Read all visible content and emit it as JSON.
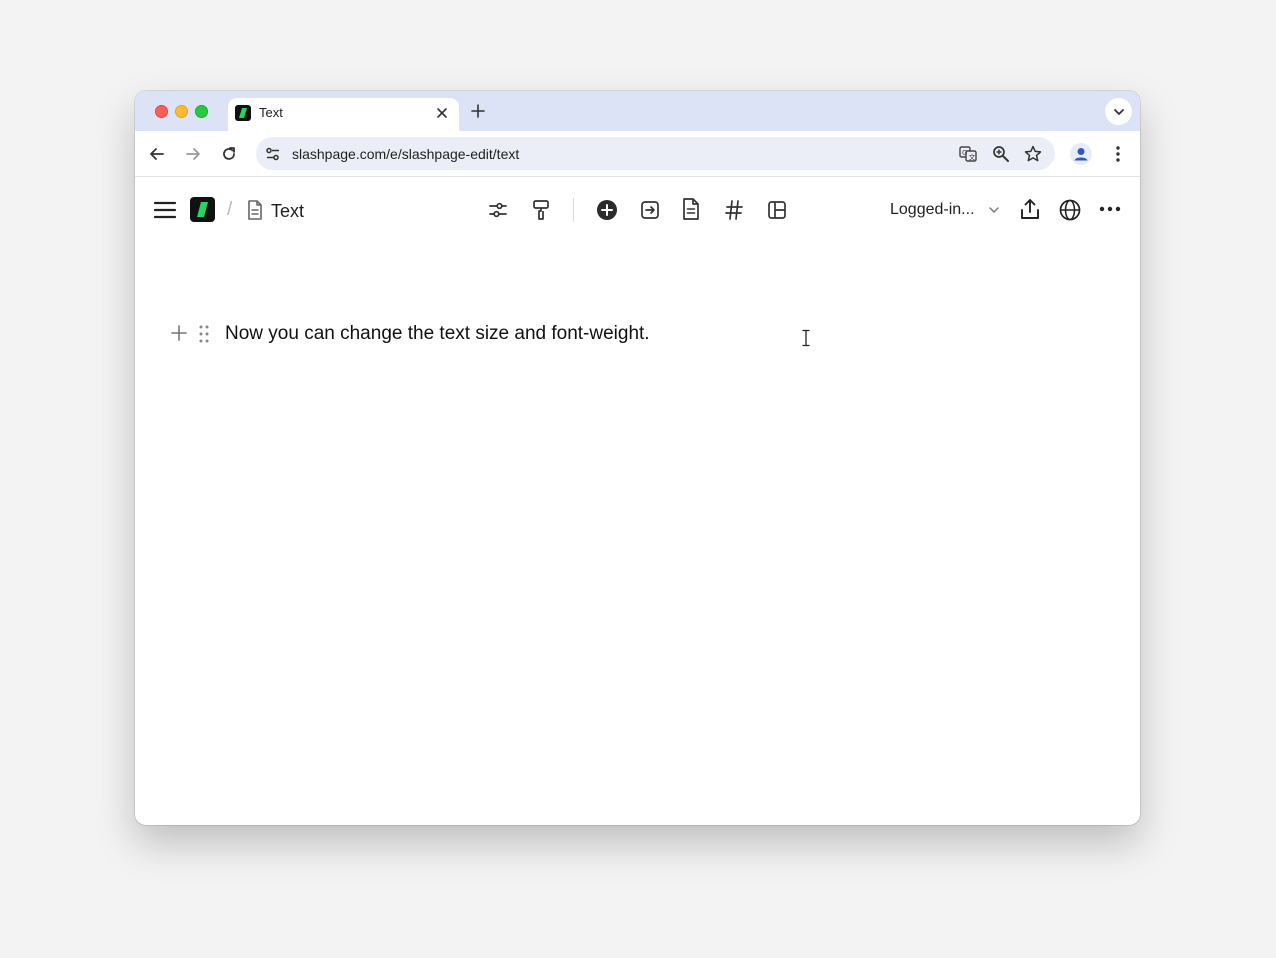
{
  "browser": {
    "tab_title": "Text",
    "url": "slashpage.com/e/slashpage-edit/text",
    "icons": {
      "close": "close-icon",
      "new_tab": "plus-icon",
      "tab_search": "chevron-down-icon",
      "back": "arrow-left-icon",
      "forward": "arrow-right-icon",
      "reload": "reload-icon",
      "site_info": "tune-icon",
      "translate": "translate-icon",
      "zoom": "zoom-icon",
      "bookmark": "star-icon",
      "profile": "person-icon",
      "menu": "kebab-icon"
    }
  },
  "app": {
    "breadcrumb_separator": "/",
    "page_title": "Text",
    "visibility_label": "Logged-in...",
    "toolbar_icons": [
      "sliders-icon",
      "paint-roller-icon",
      "plus-circle-icon",
      "arrow-into-box-icon",
      "document-icon",
      "hash-icon",
      "layout-icon"
    ],
    "right_icons": [
      "share-icon",
      "globe-icon",
      "more-icon"
    ],
    "brand_color": "#22d65e"
  },
  "editor": {
    "blocks": [
      {
        "text": "Now you can change the text size and font-weight."
      }
    ]
  }
}
